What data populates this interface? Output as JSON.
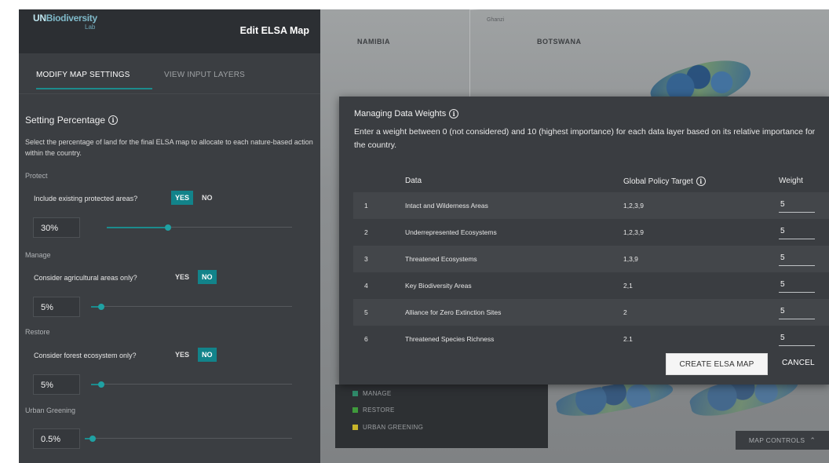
{
  "panel": {
    "logo_prefix": "UN",
    "logo_main": "Biodiversity",
    "logo_sub": "Lab",
    "title": "Edit ELSA Map",
    "tabs": [
      {
        "label": "MODIFY MAP SETTINGS",
        "active": true
      },
      {
        "label": "VIEW INPUT LAYERS",
        "active": false
      }
    ],
    "setting_title": "Setting Percentage",
    "setting_desc": "Select the percentage of land for the final ELSA map to allocate to each nature-based action within the country.",
    "sections": [
      {
        "label": "Protect",
        "question": "Include existing protected areas?",
        "yes": "YES",
        "no": "NO",
        "selected": "YES",
        "percent_text": "30%",
        "slider_fraction": 0.3
      },
      {
        "label": "Manage",
        "question": "Consider agricultural areas only?",
        "yes": "YES",
        "no": "NO",
        "selected": "NO",
        "percent_text": "5%",
        "slider_fraction": 0.05
      },
      {
        "label": "Restore",
        "question": "Consider forest ecosystem only?",
        "yes": "YES",
        "no": "NO",
        "selected": "NO",
        "percent_text": "5%",
        "slider_fraction": 0.05
      },
      {
        "label": "Urban Greening",
        "percent_text": "0.5%",
        "slider_fraction": 0.005
      }
    ]
  },
  "map": {
    "country_labels": [
      "NAMIBIA",
      "BOTSWANA"
    ],
    "town_label": "Ghanzi"
  },
  "modal": {
    "title": "Managing Data Weights",
    "desc": "Enter a weight between 0 (not considered) and 10 (highest importance) for each data layer based on its relative importance for the country.",
    "columns": {
      "data": "Data",
      "target": "Global Policy Target",
      "weight": "Weight"
    },
    "rows": [
      {
        "num": "1",
        "data": "Intact and Wilderness Areas",
        "target": "1,2,3,9",
        "weight": "5"
      },
      {
        "num": "2",
        "data": "Underrepresented Ecosystems",
        "target": "1,2,3,9",
        "weight": "5"
      },
      {
        "num": "3",
        "data": "Threatened Ecosystems",
        "target": "1,3,9",
        "weight": "5"
      },
      {
        "num": "4",
        "data": "Key Biodiversity Areas",
        "target": "2,1",
        "weight": "5"
      },
      {
        "num": "5",
        "data": "Alliance for Zero Extinction Sites",
        "target": "2",
        "weight": "5"
      },
      {
        "num": "6",
        "data": "Threatened Species Richness",
        "target": "2.1",
        "weight": "5"
      }
    ],
    "create_label": "CREATE ELSA MAP",
    "cancel_label": "CANCEL"
  },
  "legend": {
    "items": [
      {
        "label": "MANAGE",
        "color": "#2f8a6a"
      },
      {
        "label": "RESTORE",
        "color": "#3f9a3c"
      },
      {
        "label": "URBAN GREENING",
        "color": "#c8b52a"
      }
    ]
  },
  "map_controls": {
    "label": "MAP CONTROLS",
    "icon": "chevron-up-icon"
  },
  "colors": {
    "accent": "#12838a",
    "panel_bg": "#3b3e42",
    "modal_bg": "#3a3d41"
  }
}
